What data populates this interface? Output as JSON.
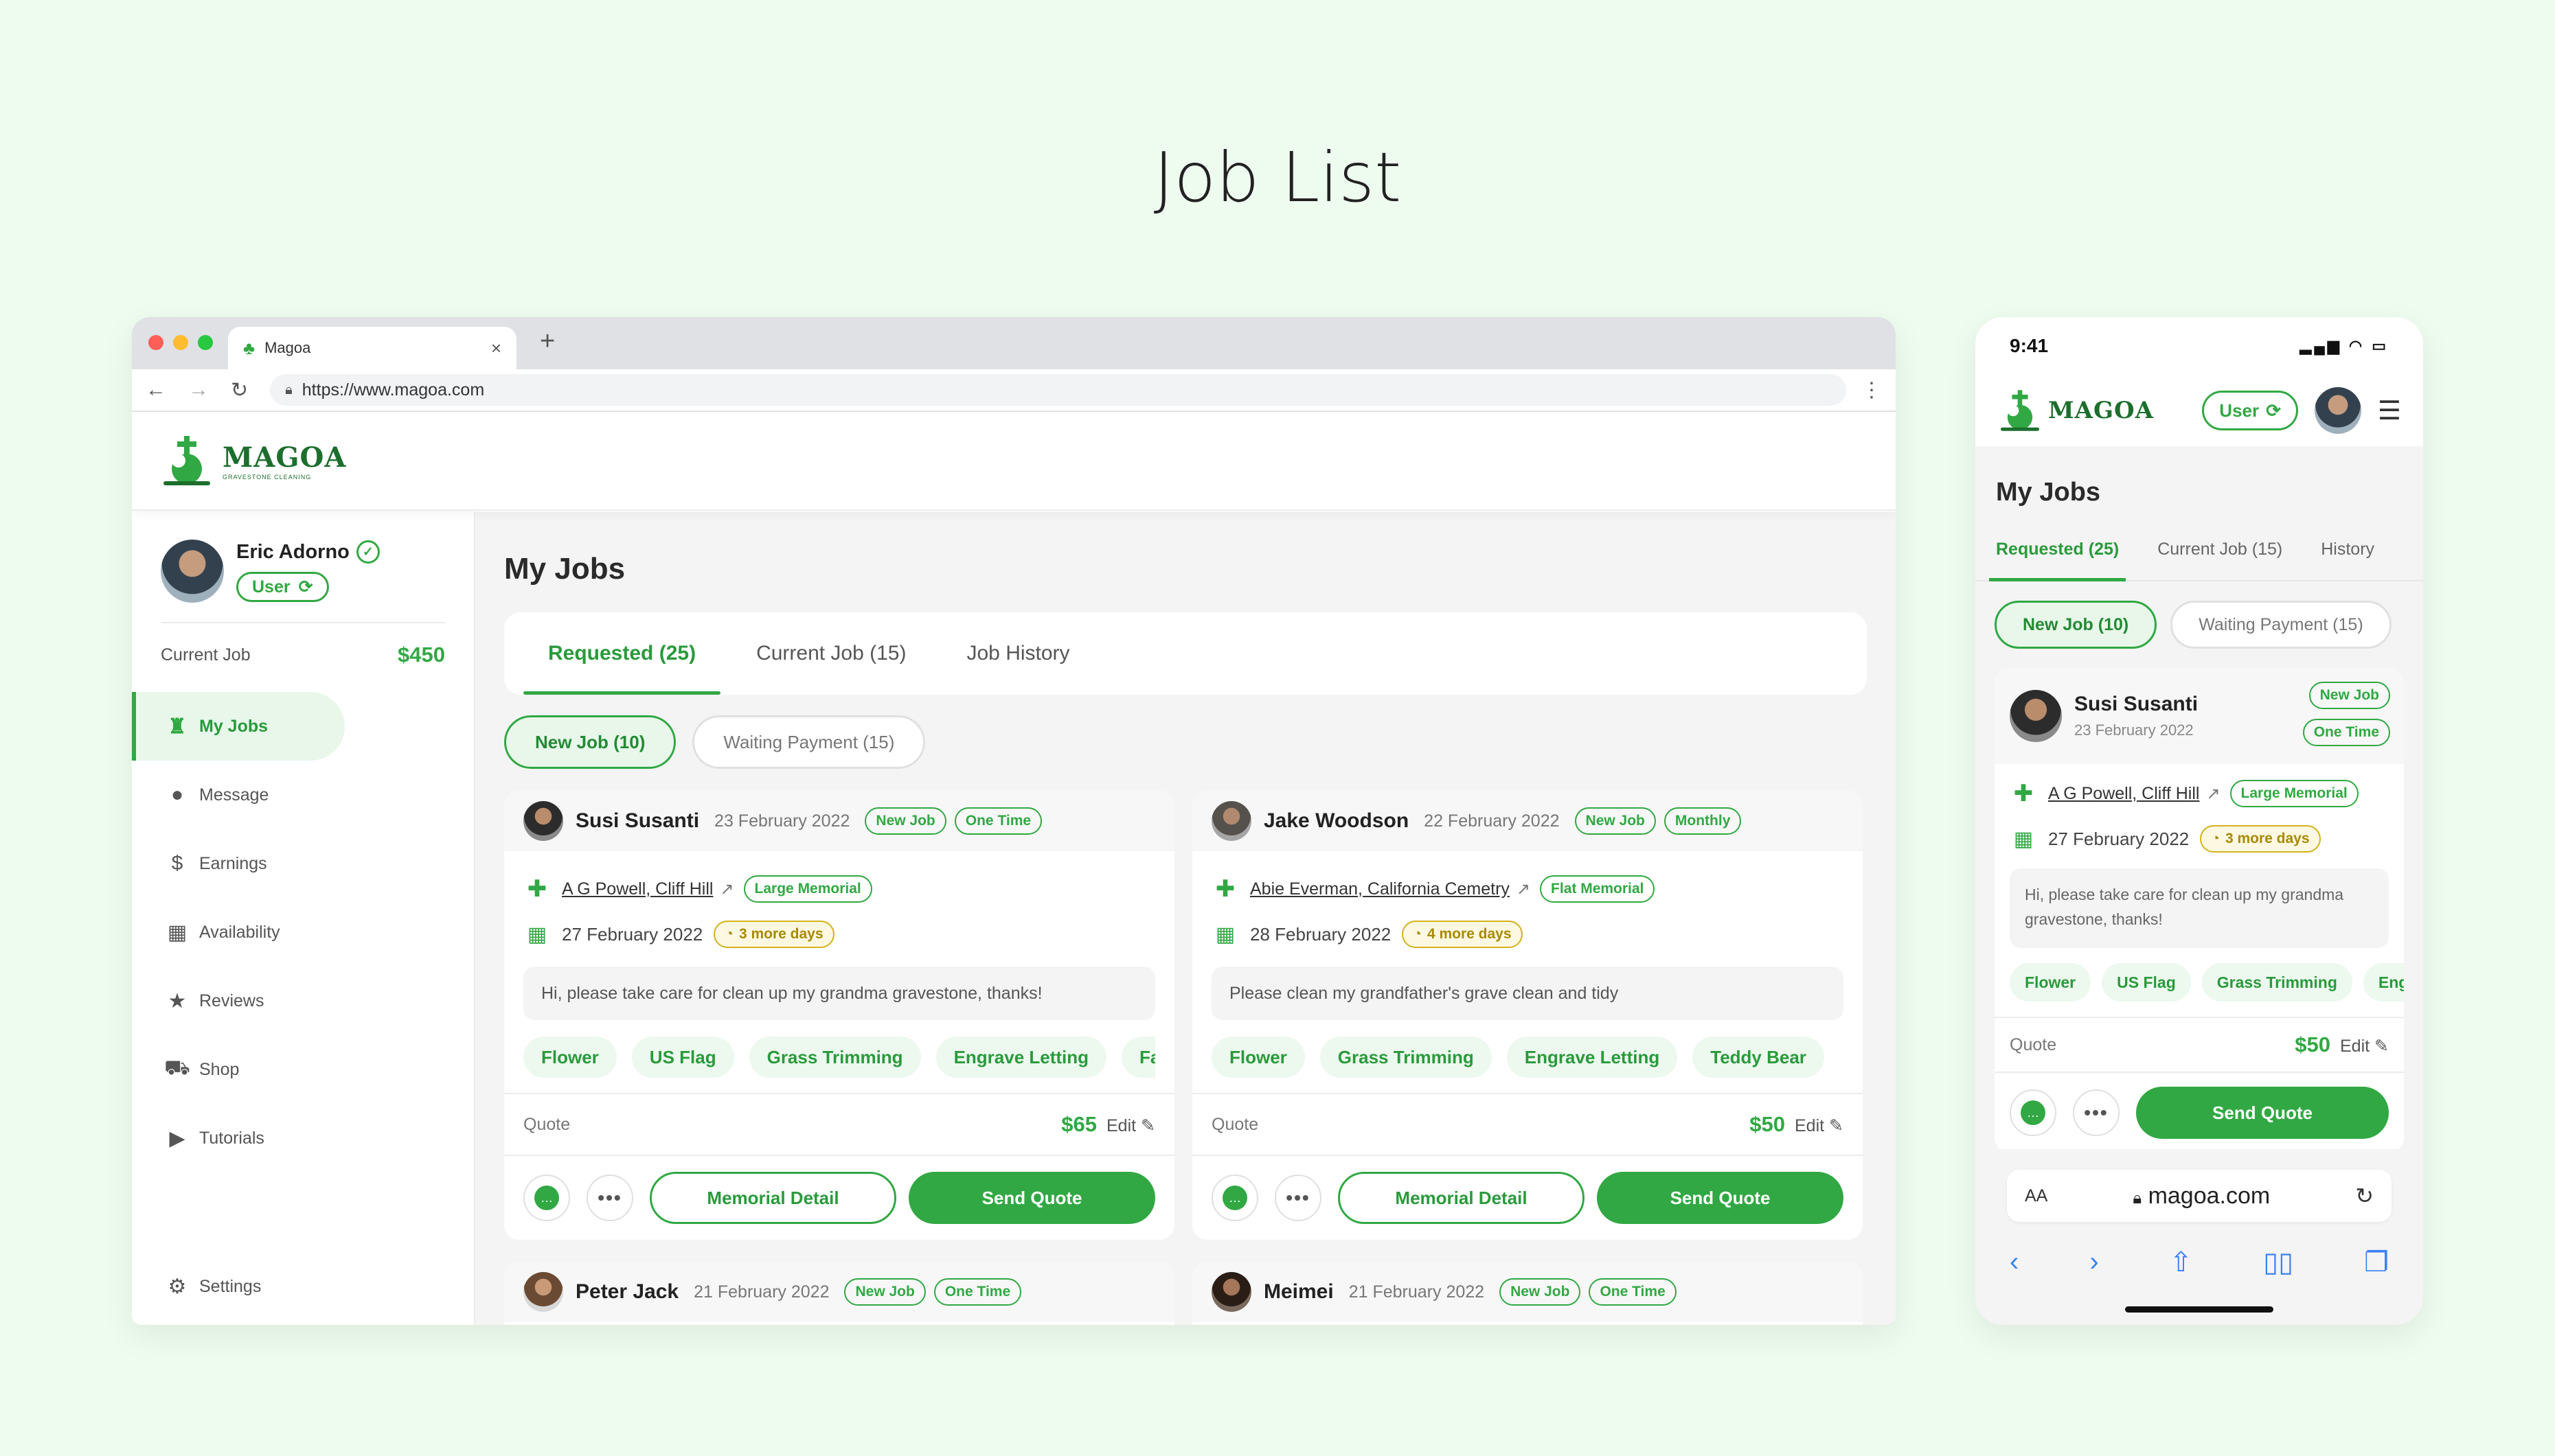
{
  "page_title": "Job List",
  "browser": {
    "tab_title": "Magoa",
    "tab_close": "×",
    "new_tab": "+",
    "url": "https://www.magoa.com",
    "nav": {
      "back": "←",
      "forward": "→",
      "reload": "↻",
      "menu": "⋮"
    }
  },
  "brand": {
    "name": "MAGOA",
    "tagline": "GRAVESTONE CLEANING",
    "color": "#31a843"
  },
  "profile": {
    "name": "Eric Adorno",
    "role": "User",
    "current_job_label": "Current Job",
    "current_job_value": "$450"
  },
  "sidebar": {
    "items": [
      {
        "label": "My Jobs",
        "icon": "broom-icon",
        "glyph": "♜"
      },
      {
        "label": "Message",
        "icon": "chat-icon",
        "glyph": "●"
      },
      {
        "label": "Earnings",
        "icon": "dollar-icon",
        "glyph": "$"
      },
      {
        "label": "Availability",
        "icon": "calendar-icon",
        "glyph": "▦"
      },
      {
        "label": "Reviews",
        "icon": "star-icon",
        "glyph": "★"
      },
      {
        "label": "Shop",
        "icon": "cart-icon",
        "glyph": "⛟"
      },
      {
        "label": "Tutorials",
        "icon": "play-icon",
        "glyph": "▶"
      }
    ],
    "settings": {
      "label": "Settings",
      "icon": "gear-icon",
      "glyph": "⚙"
    }
  },
  "main": {
    "title": "My Jobs",
    "tabs": [
      "Requested (25)",
      "Current Job (15)",
      "Job History"
    ],
    "filters": [
      "New Job (10)",
      "Waiting Payment (15)"
    ],
    "quote_label": "Quote",
    "edit_label": "Edit",
    "memorial_btn": "Memorial Detail",
    "send_btn": "Send Quote"
  },
  "jobs": [
    {
      "name": "Susi Susanti",
      "date": "23 February 2022",
      "tags": [
        "New Job",
        "One Time"
      ],
      "location": "A G Powell, Cliff Hill",
      "memorial": "Large Memorial",
      "due": "27 February 2022",
      "remaining": "3 more days",
      "message": "Hi, please take care for clean up my grandma gravestone, thanks!",
      "services": [
        "Flower",
        "US Flag",
        "Grass Trimming",
        "Engrave Letting",
        "Family Photo"
      ],
      "quote": "$65"
    },
    {
      "name": "Jake Woodson",
      "date": "22 February 2022",
      "tags": [
        "New Job",
        "Monthly"
      ],
      "location": "Abie Everman, California Cemetry",
      "memorial": "Flat Memorial",
      "due": "28 February 2022",
      "remaining": "4 more days",
      "message": "Please clean my grandfather's grave clean and tidy",
      "services": [
        "Flower",
        "Grass Trimming",
        "Engrave Letting",
        "Teddy Bear"
      ],
      "quote": "$50"
    },
    {
      "name": "Peter Jack",
      "date": "21 February 2022",
      "tags": [
        "New Job",
        "One Time"
      ]
    },
    {
      "name": "Meimei",
      "date": "21 February 2022",
      "tags": [
        "New Job",
        "One Time"
      ]
    }
  ],
  "phone": {
    "time": "9:41",
    "role": "User",
    "title": "My Jobs",
    "tabs": [
      "Requested (25)",
      "Current Job (15)",
      "History"
    ],
    "filters": [
      "New Job (10)",
      "Waiting Payment (15)"
    ],
    "job": {
      "name": "Susi Susanti",
      "date": "23 February 2022",
      "tags": [
        "New Job",
        "One Time"
      ],
      "location": "A G Powell, Cliff Hill",
      "memorial": "Large Memorial",
      "due": "27 February 2022",
      "remaining": "3 more days",
      "message": "Hi, please take care for clean up my grandma gravestone, thanks!",
      "services": [
        "Flower",
        "US Flag",
        "Grass Trimming",
        "Engrave Letting"
      ],
      "quote": "$50"
    },
    "quote_label": "Quote",
    "edit_label": "Edit",
    "send_btn": "Send Quote",
    "safari": {
      "aa": "AA",
      "domain": "magoa.com"
    }
  }
}
